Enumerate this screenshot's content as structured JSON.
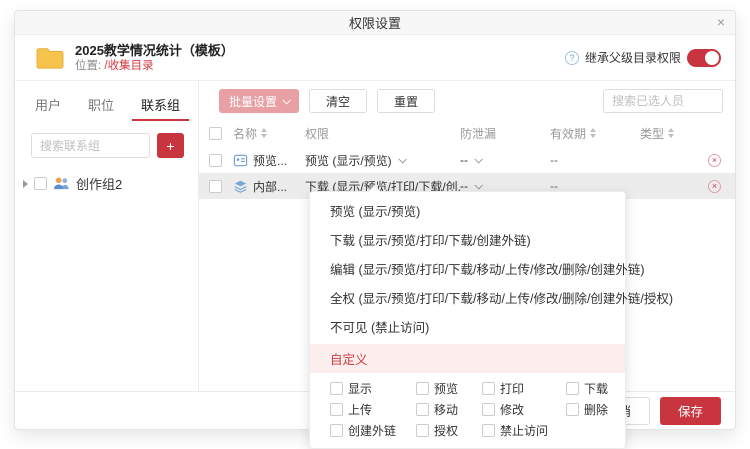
{
  "icons": {
    "close": "×",
    "add": "+",
    "help": "?",
    "remove": "×"
  },
  "colors": {
    "accent_red": "#c9353f",
    "batch_pink": "#e9a0a4",
    "row_highlight": "#ececec",
    "custom_row_bg": "#fdeeee",
    "folder_yellow": "#f6c34c"
  },
  "dialog": {
    "title": "权限设置",
    "header": {
      "folder_name": "2025教学情况统计（模板）",
      "location_label": "位置:",
      "location_path": "/收集目录",
      "inherit_label": "继承父级目录权限",
      "inherit_on": true
    },
    "sidebar": {
      "tabs": [
        {
          "label": "用户",
          "active": false
        },
        {
          "label": "职位",
          "active": false
        },
        {
          "label": "联系组",
          "active": true
        }
      ],
      "search_placeholder": "搜索联系组",
      "tree": [
        {
          "label": "创作组2"
        }
      ]
    },
    "toolbar": {
      "batch_button": "批量设置",
      "clear_button": "清空",
      "reset_button": "重置",
      "search_placeholder": "搜索已选人员"
    },
    "table": {
      "columns": {
        "name": "名称",
        "permission": "权限",
        "leakproof": "防泄漏",
        "validity": "有效期",
        "type": "类型"
      },
      "rows": [
        {
          "name": "预览...",
          "permission": "预览 (显示/预览)",
          "leakproof": "--",
          "validity": "--",
          "type": "",
          "highlighted": false
        },
        {
          "name": "内部...",
          "permission": "下载 (显示/预览/打印/下载/创...",
          "leakproof": "--",
          "validity": "--",
          "type": "",
          "highlighted": true
        }
      ]
    },
    "dropdown": {
      "items": [
        "预览 (显示/预览)",
        "下载 (显示/预览/打印/下载/创建外链)",
        "编辑 (显示/预览/打印/下载/移动/上传/修改/删除/创建外链)",
        "全权 (显示/预览/打印/下载/移动/上传/修改/删除/创建外链/授权)",
        "不可见 (禁止访问)"
      ],
      "custom_label": "自定义",
      "custom_options": [
        "显示",
        "预览",
        "打印",
        "下载",
        "上传",
        "移动",
        "修改",
        "删除",
        "创建外链",
        "授权",
        "禁止访问"
      ]
    },
    "footer": {
      "cancel_label": "取消",
      "save_label": "保存"
    }
  }
}
